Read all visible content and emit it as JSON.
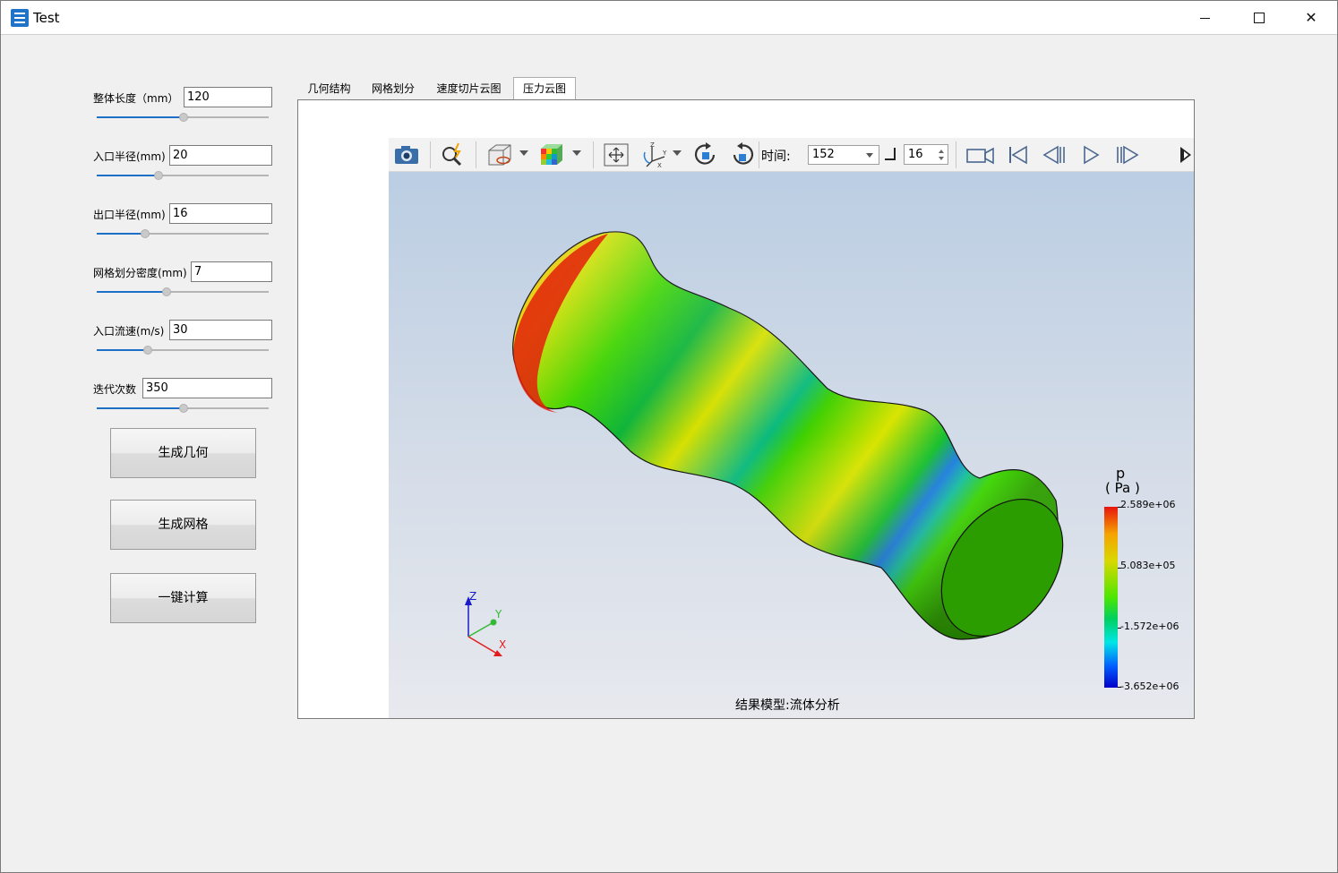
{
  "window": {
    "title": "Test",
    "minimize": "—",
    "maximize": "☐",
    "close": "✕"
  },
  "params": [
    {
      "label": "整体长度（mm）",
      "value": "120",
      "slider": 0.5
    },
    {
      "label": "入口半径(mm)",
      "value": "20",
      "slider": 0.36
    },
    {
      "label": "出口半径(mm)",
      "value": "16",
      "slider": 0.28
    },
    {
      "label": "网格划分密度(mm)",
      "value": "7",
      "slider": 0.41
    },
    {
      "label": "入口流速(m/s)",
      "value": "30",
      "slider": 0.3
    },
    {
      "label": "迭代次数",
      "value": "350",
      "slider": 0.5
    }
  ],
  "buttons": {
    "gen_geometry": "生成几何",
    "gen_mesh": "生成网格",
    "compute": "一键计算"
  },
  "tabs": [
    {
      "label": "几何结构",
      "active": false
    },
    {
      "label": "网格划分",
      "active": false
    },
    {
      "label": "速度切片云图",
      "active": false
    },
    {
      "label": "压力云图",
      "active": true
    }
  ],
  "toolbar": {
    "time_label": "时间:",
    "time_value": "152",
    "step_value": "16",
    "icons": [
      "camera-icon",
      "zoom-icon",
      "box-view-icon",
      "color-cube-icon",
      "fit-view-icon",
      "axes-icon",
      "rotate-cw-icon",
      "rotate-ccw-icon",
      "record-icon",
      "first-frame-icon",
      "prev-frame-icon",
      "play-icon",
      "next-frame-icon",
      "expand-icon"
    ]
  },
  "legend": {
    "title": "p",
    "unit": "( Pa )",
    "labels": [
      "2.589e+06",
      "5.083e+05",
      "-1.572e+06",
      "-3.652e+06"
    ],
    "colors": {
      "max": "#e8140f",
      "mid": "#4ee600",
      "low": "#00e6e6",
      "min": "#0000c8"
    }
  },
  "axes": {
    "z": "Z",
    "y": "Y",
    "x": "X"
  },
  "caption": "结果模型:流体分析"
}
